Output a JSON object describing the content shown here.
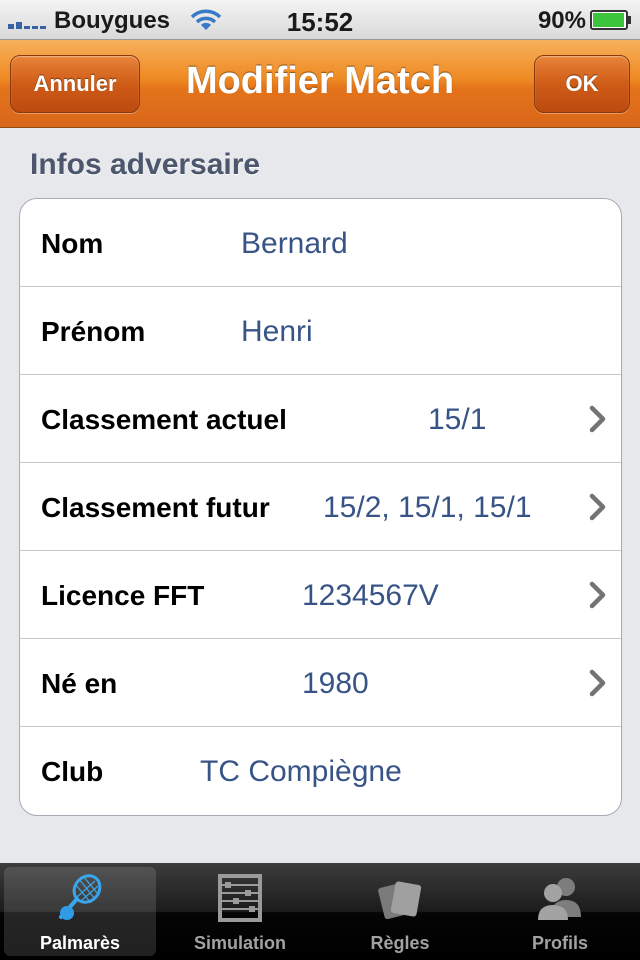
{
  "status_bar": {
    "carrier": "Bouygues",
    "time": "15:52",
    "battery_percent": "90%"
  },
  "nav": {
    "cancel_label": "Annuler",
    "title": "Modifier Match",
    "ok_label": "OK"
  },
  "section": {
    "header": "Infos adversaire"
  },
  "rows": [
    {
      "label": "Nom",
      "value": "Bernard",
      "chevron": false
    },
    {
      "label": "Prénom",
      "value": "Henri",
      "chevron": false
    },
    {
      "label": "Classement actuel",
      "value": "15/1",
      "chevron": true
    },
    {
      "label": "Classement futur",
      "value": "15/2, 15/1, 15/1",
      "chevron": true
    },
    {
      "label": "Licence FFT",
      "value": "1234567V",
      "chevron": true
    },
    {
      "label": "Né en",
      "value": "1980",
      "chevron": true
    },
    {
      "label": "Club",
      "value": "TC Compiègne",
      "chevron": false
    }
  ],
  "tabs": [
    {
      "label": "Palmarès",
      "icon": "tennis-racket-icon",
      "active": true
    },
    {
      "label": "Simulation",
      "icon": "abacus-icon",
      "active": false
    },
    {
      "label": "Règles",
      "icon": "cards-icon",
      "active": false
    },
    {
      "label": "Profils",
      "icon": "people-icon",
      "active": false
    }
  ],
  "colors": {
    "nav_accent": "#e4741a",
    "value_text": "#385487",
    "section_header": "#4c566c",
    "active_tab_icon": "#2f9be6"
  }
}
